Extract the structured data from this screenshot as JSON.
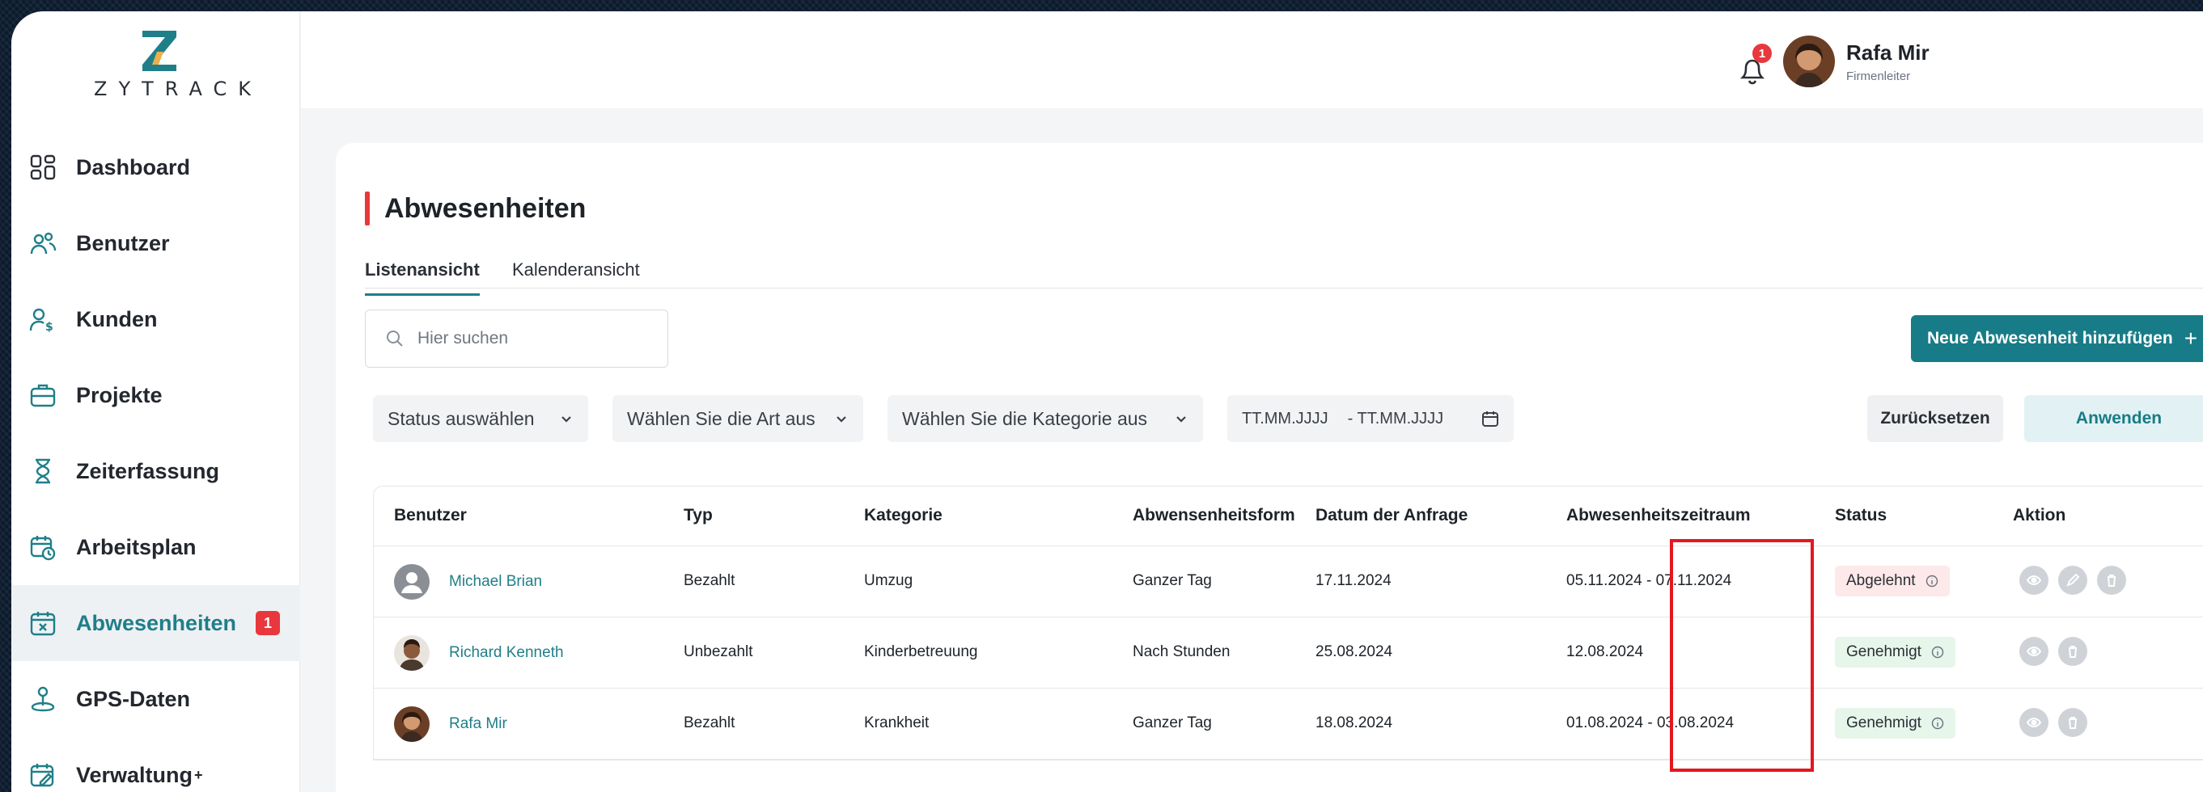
{
  "brand": {
    "name": "ZYTRACK"
  },
  "sidebar": {
    "items": [
      {
        "label": "Dashboard",
        "icon": "dashboard-icon"
      },
      {
        "label": "Benutzer",
        "icon": "users-icon"
      },
      {
        "label": "Kunden",
        "icon": "customers-icon"
      },
      {
        "label": "Projekte",
        "icon": "briefcase-icon"
      },
      {
        "label": "Zeiterfassung",
        "icon": "hourglass-icon"
      },
      {
        "label": "Arbeitsplan",
        "icon": "calendar-clock-icon"
      },
      {
        "label": "Abwesenheiten",
        "icon": "calendar-x-icon",
        "badge": "1",
        "active": true
      },
      {
        "label": "GPS-Daten",
        "icon": "location-icon"
      },
      {
        "label": "Verwaltung",
        "sup": "+",
        "icon": "calendar-edit-icon"
      }
    ]
  },
  "topbar": {
    "notification_count": "1",
    "user_name": "Rafa Mir",
    "user_role": "Firmenleiter"
  },
  "page": {
    "title": "Abwesenheiten",
    "tabs": [
      "Listenansicht",
      "Kalenderansicht"
    ],
    "search_placeholder": "Hier suchen",
    "add_button": "Neue Abwesenheit hinzufügen",
    "filters": {
      "status": "Status auswählen",
      "type": "Wählen Sie die Art aus",
      "category": "Wählen Sie die Kategorie aus",
      "date_from": "TT.MM.JJJJ",
      "date_to": "- TT.MM.JJJJ"
    },
    "reset_button": "Zurücksetzen",
    "apply_button": "Anwenden"
  },
  "table": {
    "headers": [
      "Benutzer",
      "Typ",
      "Kategorie",
      "Abwensenheitsform",
      "Datum der Anfrage",
      "Abwesenheitszeitraum",
      "Status",
      "Aktion"
    ],
    "rows": [
      {
        "user": "Michael Brian",
        "type": "Bezahlt",
        "category": "Umzug",
        "form": "Ganzer Tag",
        "request_date": "17.11.2024",
        "period": "05.11.2024 - 07.11.2024",
        "status": "Abgelehnt"
      },
      {
        "user": "Richard Kenneth",
        "type": "Unbezahlt",
        "category": "Kinderbetreuung",
        "form": "Nach Stunden",
        "request_date": "25.08.2024",
        "period": "12.08.2024",
        "status": "Genehmigt"
      },
      {
        "user": "Rafa Mir",
        "type": "Bezahlt",
        "category": "Krankheit",
        "form": "Ganzer Tag",
        "request_date": "18.08.2024",
        "period": "01.08.2024 - 03.08.2024",
        "status": "Genehmigt"
      }
    ]
  },
  "colors": {
    "accent": "#177c87",
    "danger": "#e8383d",
    "highlight": "#e3171f"
  }
}
